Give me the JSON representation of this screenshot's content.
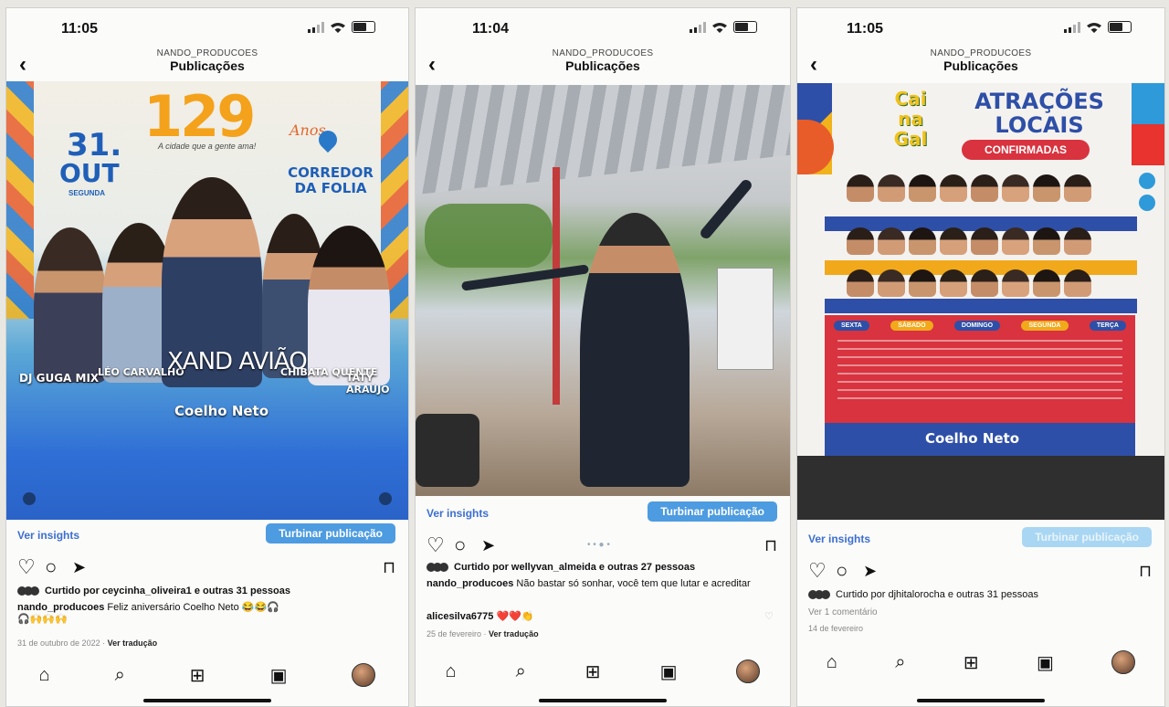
{
  "screens": [
    {
      "time": "11:05",
      "account": "NANDO_PRODUCOES",
      "title": "Publicações",
      "poster": {
        "number": "129",
        "anos": "Anos",
        "tagline": "A cidade que a gente ama!",
        "date_day": "31.",
        "date_month": "OUT",
        "date_weekday": "SEGUNDA",
        "venue": "CORREDOR DA FOLIA",
        "artists": [
          "DJ GUGA MIX",
          "LÉO CARVALHO",
          "XAND AVIÃO",
          "CHIBATA QUENTE",
          "TATY ARAÚJO"
        ],
        "brand": "Coelho Neto"
      },
      "insights": "Ver insights",
      "boost": "Turbinar publicação",
      "likes": "Curtido por ceycinha_oliveira1 e outras 31 pessoas",
      "caption_user": "nando_producoes",
      "caption_text": "Feliz aniversário Coelho Neto 😂😂🎧",
      "caption_extra": "🎧🙌🙌🙌",
      "date": "31 de outubro de 2022",
      "translate": "Ver tradução"
    },
    {
      "time": "11:04",
      "account": "NANDO_PRODUCOES",
      "title": "Publicações",
      "insights": "Ver insights",
      "boost": "Turbinar publicação",
      "likes": "Curtido por wellyvan_almeida e outras 27 pessoas",
      "caption_user": "nando_producoes",
      "caption_text": "Não bastar só sonhar, você tem que lutar e acreditar",
      "comment_user": "alicesilva6775",
      "comment_text": "❤️❤️👏",
      "date": "25 de fevereiro",
      "translate": "Ver tradução"
    },
    {
      "time": "11:05",
      "account": "NANDO_PRODUCOES",
      "title": "Publicações",
      "poster": {
        "logo": "Cai na Gal",
        "heading1": "ATRAÇÕES",
        "heading2": "LOCAIS",
        "badge": "CONFIRMADAS",
        "days": [
          "SEXTA",
          "SÁBADO",
          "DOMINGO",
          "SEGUNDA",
          "TERÇA"
        ],
        "brand": "Coelho Neto"
      },
      "insights": "Ver insights",
      "boost": "Turbinar publicação",
      "likes": "Curtido por djhitalorocha e outras 31 pessoas",
      "comments": "Ver 1 comentário",
      "date": "14 de fevereiro"
    }
  ],
  "colors": {
    "boost": "#4d9be0",
    "link": "#3c6fd0",
    "poster1_blue": "#2f6fd6",
    "poster3_red": "#d8333e",
    "poster3_blue": "#2e4fa7"
  },
  "icons": [
    "back-arrow-icon",
    "heart-icon",
    "comment-icon",
    "share-icon",
    "bookmark-icon",
    "home-icon",
    "search-icon",
    "add-icon",
    "reels-icon"
  ]
}
